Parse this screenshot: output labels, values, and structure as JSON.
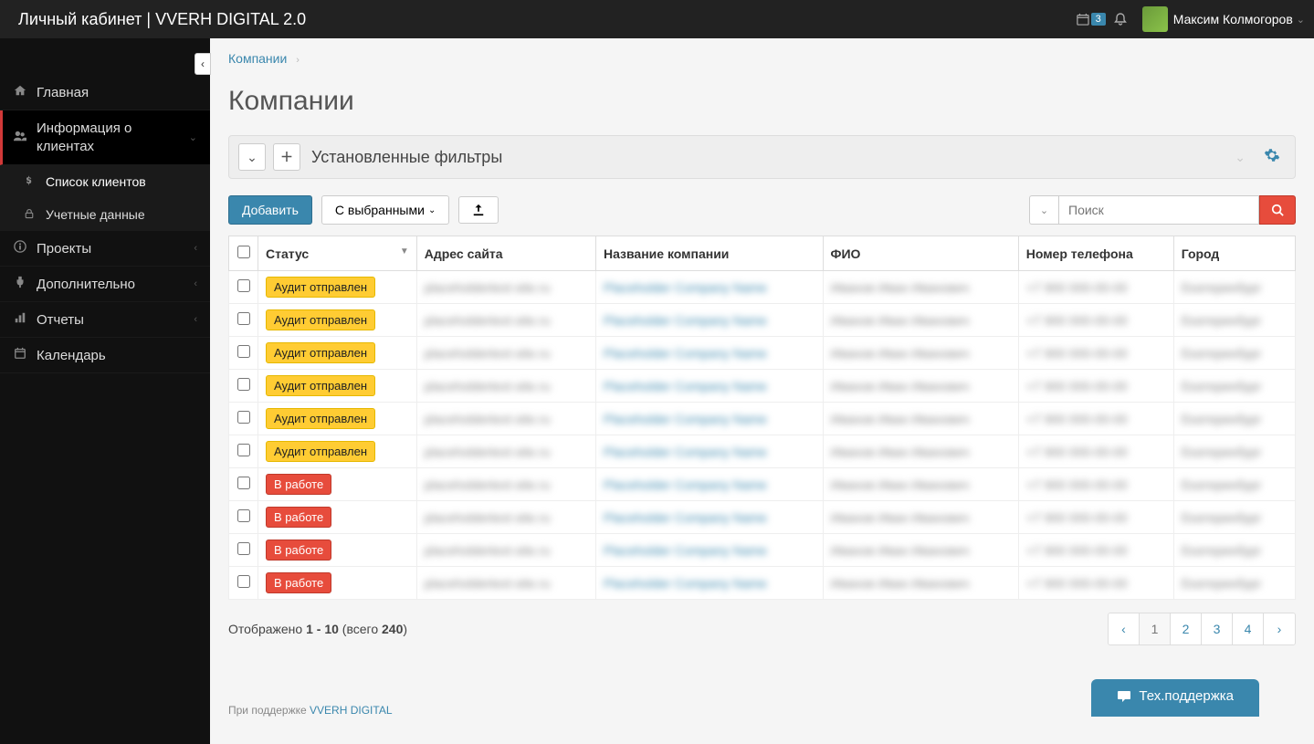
{
  "topbar": {
    "brand": "Личный кабинет | VVERH DIGITAL 2.0",
    "notif_badge": "3",
    "user_name": "Максим Колмогоров"
  },
  "sidebar": {
    "items": [
      {
        "icon": "home",
        "label": "Главная"
      },
      {
        "icon": "users",
        "label": "Информация о клиентах",
        "expanded": true,
        "active": true,
        "children": [
          {
            "icon": "dollar",
            "label": "Список клиентов",
            "selected": true
          },
          {
            "icon": "lock",
            "label": "Учетные данные"
          }
        ]
      },
      {
        "icon": "info",
        "label": "Проекты",
        "chev": true
      },
      {
        "icon": "plug",
        "label": "Дополнительно",
        "chev": true
      },
      {
        "icon": "chart",
        "label": "Отчеты",
        "chev": true
      },
      {
        "icon": "cal",
        "label": "Календарь"
      }
    ]
  },
  "breadcrumb": {
    "item": "Компании"
  },
  "page": {
    "title": "Компании"
  },
  "filters": {
    "title": "Установленные фильтры"
  },
  "toolbar": {
    "add_label": "Добавить",
    "selected_label": "С выбранными",
    "search_placeholder": "Поиск"
  },
  "columns": {
    "status": "Статус",
    "site": "Адрес сайта",
    "company": "Название компании",
    "fio": "ФИО",
    "phone": "Номер телефона",
    "city": "Город"
  },
  "status_labels": {
    "audit": "Аудит отправлен",
    "work": "В работе"
  },
  "rows": [
    {
      "status": "audit"
    },
    {
      "status": "audit"
    },
    {
      "status": "audit"
    },
    {
      "status": "audit"
    },
    {
      "status": "audit"
    },
    {
      "status": "audit"
    },
    {
      "status": "work"
    },
    {
      "status": "work"
    },
    {
      "status": "work"
    },
    {
      "status": "work"
    }
  ],
  "footer": {
    "shown_label": "Отображено",
    "range": "1 - 10",
    "total_label": "(всего",
    "total": "240",
    "close": ")"
  },
  "pager": {
    "pages": [
      "1",
      "2",
      "3",
      "4"
    ],
    "current": "1"
  },
  "support": {
    "prefix": "При поддержке",
    "link": "VVERH DIGITAL"
  },
  "tech": {
    "label": "Тех.поддержка"
  }
}
